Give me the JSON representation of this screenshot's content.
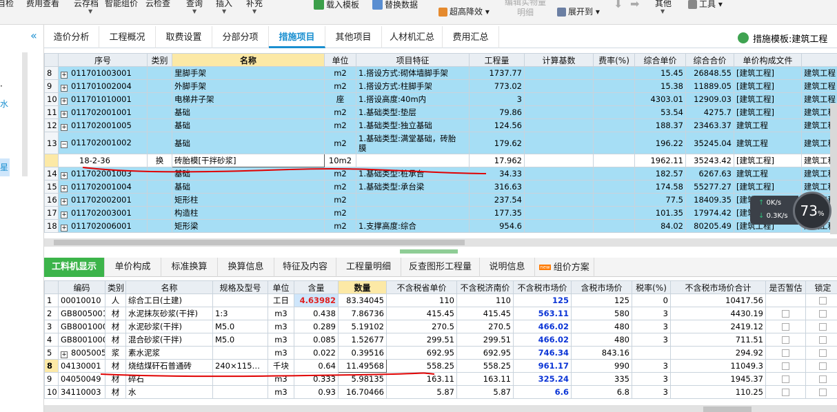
{
  "ribbon": {
    "items": [
      "自检",
      "费用查看",
      "云存档",
      "智能组价",
      "云检查",
      "查询",
      "插入",
      "补充",
      "载入模板",
      "替换数据",
      "超高降效",
      "编辑实物量明细",
      "展开到",
      "其他",
      "工具"
    ]
  },
  "left_strip": {
    "text1": "水",
    "text2": "星"
  },
  "tabs": [
    "造价分析",
    "工程概况",
    "取费设置",
    "分部分项",
    "措施项目",
    "其他项目",
    "人材机汇总",
    "费用汇总"
  ],
  "active_tab": "措施项目",
  "template_label": "措施模板:建筑工程",
  "upper_table": {
    "headers": [
      "序号",
      "类别",
      "名称",
      "单位",
      "项目特征",
      "工程量",
      "计算基数",
      "费率(%)",
      "综合单价",
      "综合合价",
      "单价构成文件",
      ""
    ],
    "rows": [
      {
        "n": "8",
        "code": "011701003001",
        "cat": "",
        "name": "里脚手架",
        "unit": "m2",
        "feature": "1.搭设方式:砌体墙脚手架",
        "qty": "1737.77",
        "base": "",
        "rate": "",
        "price": "15.45",
        "total": "26848.55",
        "file": "[建筑工程]",
        "ext": "建筑工程"
      },
      {
        "n": "9",
        "code": "011701002004",
        "cat": "",
        "name": "外脚手架",
        "unit": "m2",
        "feature": "1.搭设方式:柱脚手架",
        "qty": "773.02",
        "base": "",
        "rate": "",
        "price": "15.38",
        "total": "11889.05",
        "file": "[建筑工程]",
        "ext": "建筑工程"
      },
      {
        "n": "10",
        "code": "011701010001",
        "cat": "",
        "name": "电梯井子架",
        "unit": "座",
        "feature": "1.搭设高度:40m内",
        "qty": "3",
        "base": "",
        "rate": "",
        "price": "4303.01",
        "total": "12909.03",
        "file": "[建筑工程]",
        "ext": "建筑工程"
      },
      {
        "n": "11",
        "code": "011702001001",
        "cat": "",
        "name": "基础",
        "unit": "m2",
        "feature": "1.基础类型:垫层",
        "qty": "79.86",
        "base": "",
        "rate": "",
        "price": "53.54",
        "total": "4275.7",
        "file": "[建筑工程]",
        "ext": "建筑工程"
      },
      {
        "n": "12",
        "code": "011702001005",
        "cat": "",
        "name": "基础",
        "unit": "m2",
        "feature": "1.基础类型:独立基础",
        "qty": "124.56",
        "base": "",
        "rate": "",
        "price": "188.37",
        "total": "23463.37",
        "file": "建筑工程",
        "ext": "建筑工程"
      },
      {
        "n": "13",
        "code": "011702001002",
        "cat": "",
        "name": "基础",
        "unit": "m2",
        "feature": "1.基础类型:满堂基础，砖胎",
        "feature2": "膜",
        "qty": "179.62",
        "base": "",
        "rate": "",
        "price": "196.22",
        "total": "35245.04",
        "file": "建筑工程",
        "ext": "建筑工程"
      },
      {
        "n": "",
        "code": "18-2-36",
        "cat": "换",
        "name": "砖胎模[干拌砂浆]",
        "unit": "10m2",
        "feature": "",
        "qty": "17.962",
        "base": "",
        "rate": "",
        "price": "1962.11",
        "total": "35243.42",
        "file": "[建筑工程]",
        "ext": "建筑工程"
      },
      {
        "n": "14",
        "code": "011702001003",
        "cat": "",
        "name": "基础",
        "unit": "m2",
        "feature": "1.基础类型:桩承台",
        "qty": "34.33",
        "base": "",
        "rate": "",
        "price": "182.57",
        "total": "6267.63",
        "file": "建筑工程",
        "ext": "建筑工程"
      },
      {
        "n": "15",
        "code": "011702001004",
        "cat": "",
        "name": "基础",
        "unit": "m2",
        "feature": "1.基础类型:承台梁",
        "qty": "316.63",
        "base": "",
        "rate": "",
        "price": "174.58",
        "total": "55277.27",
        "file": "[建筑工程]",
        "ext": "建筑工程"
      },
      {
        "n": "16",
        "code": "011702002001",
        "cat": "",
        "name": "矩形柱",
        "unit": "m2",
        "feature": "",
        "qty": "237.54",
        "base": "",
        "rate": "",
        "price": "77.5",
        "total": "18409.35",
        "file": "[建筑工程]",
        "ext": "建筑工程"
      },
      {
        "n": "17",
        "code": "011702003001",
        "cat": "",
        "name": "构造柱",
        "unit": "m2",
        "feature": "",
        "qty": "177.35",
        "base": "",
        "rate": "",
        "price": "101.35",
        "total": "17974.42",
        "file": "[建筑工程]",
        "ext": "建筑工程"
      },
      {
        "n": "18",
        "code": "011702006001",
        "cat": "",
        "name": "矩形梁",
        "unit": "m2",
        "feature": "1.支撑高度:综合",
        "qty": "954.6",
        "base": "",
        "rate": "",
        "price": "84.02",
        "total": "80205.49",
        "file": "[建筑工程]",
        "ext": "建筑工程"
      }
    ]
  },
  "lower_tabs": [
    "工料机显示",
    "单价构成",
    "标准换算",
    "换算信息",
    "特征及内容",
    "工程量明细",
    "反查图形工程量",
    "说明信息",
    "组价方案"
  ],
  "lower_tab_badge": "new",
  "lower_table": {
    "headers": [
      "",
      "编码",
      "类别",
      "名称",
      "规格及型号",
      "单位",
      "含量",
      "数量",
      "不含税省单价",
      "不含税济南价",
      "不含税市场价",
      "含税市场价",
      "税率(%)",
      "不含税市场价合计",
      "是否暂估",
      "锁定"
    ],
    "rows": [
      {
        "n": "1",
        "code": "00010010",
        "cat": "人",
        "name": "综合工日(土建)",
        "spec": "",
        "unit": "工日",
        "content": "4.63982",
        "qty": "83.34045",
        "p1": "110",
        "p2": "110",
        "p3": "125",
        "p4": "125",
        "tax": "0",
        "sum": "10417.56"
      },
      {
        "n": "2",
        "code": "GB80050013",
        "cat": "材",
        "name": "水泥抹灰砂浆(干拌)",
        "spec": "1:3",
        "unit": "m3",
        "content": "0.438",
        "qty": "7.86736",
        "p1": "415.45",
        "p2": "415.45",
        "p3": "563.11",
        "p4": "580",
        "tax": "3",
        "sum": "4430.19"
      },
      {
        "n": "3",
        "code": "GB80010001",
        "cat": "材",
        "name": "水泥砂浆(干拌)",
        "spec": "M5.0",
        "unit": "m3",
        "content": "0.289",
        "qty": "5.19102",
        "p1": "270.5",
        "p2": "270.5",
        "p3": "466.02",
        "p4": "480",
        "tax": "3",
        "sum": "2419.12"
      },
      {
        "n": "4",
        "code": "GB80010001",
        "cat": "材",
        "name": "混合砂浆(干拌)",
        "spec": "M5.0",
        "unit": "m3",
        "content": "0.085",
        "qty": "1.52677",
        "p1": "299.51",
        "p2": "299.51",
        "p3": "466.02",
        "p4": "480",
        "tax": "3",
        "sum": "711.51"
      },
      {
        "n": "5",
        "code": "80050057",
        "cat": "浆",
        "name": "素水泥浆",
        "spec": "",
        "unit": "m3",
        "content": "0.022",
        "qty": "0.39516",
        "p1": "692.95",
        "p2": "692.95",
        "p3": "746.34",
        "p4": "843.16",
        "tax": "",
        "sum": "294.92"
      },
      {
        "n": "8",
        "code": "04130001",
        "cat": "材",
        "name": "烧结煤矸石普通砖",
        "spec": "240×115…",
        "unit": "千块",
        "content": "0.64",
        "qty": "11.49568",
        "p1": "558.25",
        "p2": "558.25",
        "p3": "961.17",
        "p4": "990",
        "tax": "3",
        "sum": "11049.3"
      },
      {
        "n": "9",
        "code": "04050049",
        "cat": "材",
        "name": "碎石",
        "spec": "",
        "unit": "m3",
        "content": "0.333",
        "qty": "5.98135",
        "p1": "163.11",
        "p2": "163.11",
        "p3": "325.24",
        "p4": "335",
        "tax": "3",
        "sum": "1945.37"
      },
      {
        "n": "10",
        "code": "34110003",
        "cat": "材",
        "name": "水",
        "spec": "",
        "unit": "m3",
        "content": "0.93",
        "qty": "16.70466",
        "p1": "5.87",
        "p2": "5.87",
        "p3": "6.6",
        "p4": "6.8",
        "tax": "3",
        "sum": "110.25"
      }
    ]
  },
  "net_widget": {
    "up": "0K/s",
    "down": "0.3K/s",
    "percent": "73",
    "percent_unit": "%"
  },
  "colors": {
    "accent": "#1a8fd0",
    "active_green": "#3cb44a",
    "selected_row": "#a6def5",
    "annotation_red": "#e00000",
    "price_blue": "#0b35d6"
  }
}
